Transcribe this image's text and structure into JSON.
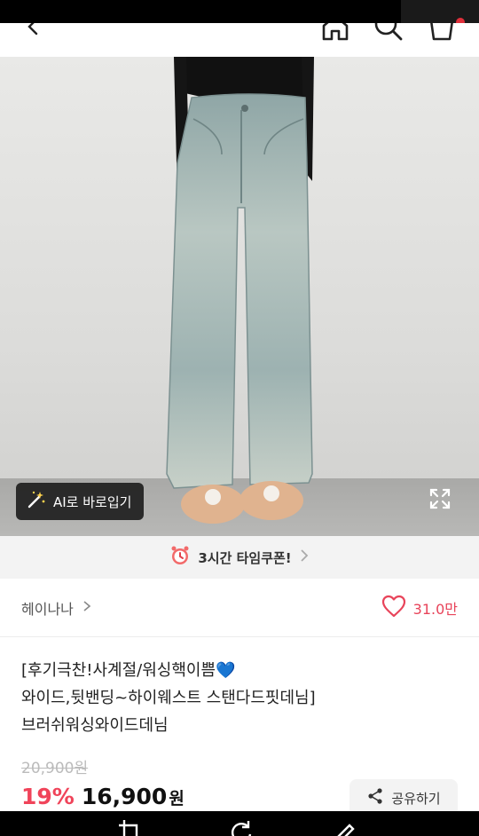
{
  "hero": {
    "ai_try_label": "AI로 바로입기"
  },
  "coupon": {
    "label": "3시간 타임쿠폰!"
  },
  "seller": {
    "name": "헤이나나",
    "likes": "31.0만"
  },
  "product": {
    "title_lines": [
      "[후기극찬!사계절/워싱핵이쁨💙",
      "와이드,뒷밴딩~하이웨스트 스탠다드핏데님]",
      "브러쉬워싱와이드데님"
    ],
    "original_price": "20,900원",
    "discount": "19%",
    "sale_price": "16,900",
    "currency": "원"
  },
  "share": {
    "label": "공유하기"
  },
  "colors": {
    "accent": "#f0445a",
    "denim": "#a7b9b7"
  }
}
